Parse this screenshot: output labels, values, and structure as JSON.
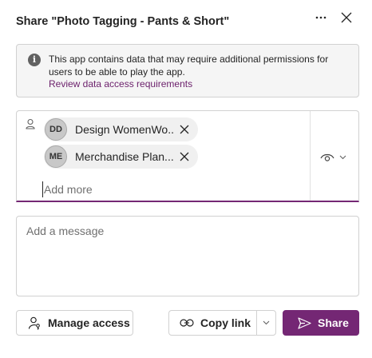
{
  "dialog": {
    "title": "Share \"Photo Tagging - Pants & Short\"",
    "more_icon": "more-horizontal-icon",
    "close_icon": "close-icon"
  },
  "info": {
    "icon": "info-icon",
    "text": "This app contains data that may require additional permissions for users to be able to play the app.",
    "link": "Review data access requirements"
  },
  "people": {
    "icon": "person-icon",
    "chips": [
      {
        "initials": "DD",
        "name": "Design WomenWo..."
      },
      {
        "initials": "ME",
        "name": "Merchandise Plan..."
      }
    ],
    "add_placeholder": "Add more",
    "permission_icon": "eye-icon"
  },
  "message": {
    "placeholder": "Add a message"
  },
  "footer": {
    "manage_access": "Manage access",
    "copy_link": "Copy link",
    "share": "Share"
  },
  "colors": {
    "accent": "#742774",
    "link": "#6b1f6b",
    "info_bg": "#f5f5f5"
  }
}
